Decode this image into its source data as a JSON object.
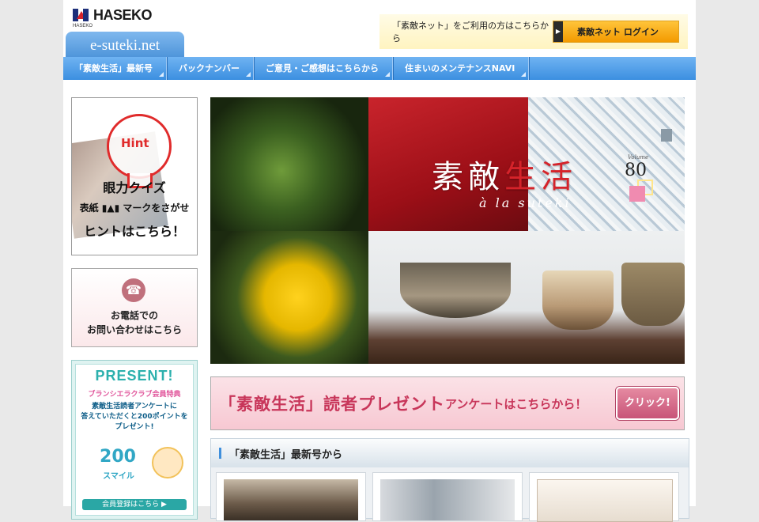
{
  "header": {
    "brand": "HASEKO",
    "brand_sub": "HASEKO",
    "site_tab": "e-suteki.net",
    "login_prompt": "「素敵ネット」をご利用の方はこちらから",
    "login_button": "素敵ネット ログイン"
  },
  "nav": {
    "items": [
      {
        "label": "「素敵生活」最新号"
      },
      {
        "label": "バックナンバー"
      },
      {
        "label": "ご意見・ご感想はこちらから"
      },
      {
        "label": "住まいのメンテナンスNAVI"
      }
    ]
  },
  "sidebar": {
    "hint": {
      "word": "Hint",
      "line1": "眼力クイズ",
      "line2": "表紙 ▮▲▮ マークをさがせ",
      "line3": "ヒントはこちら！"
    },
    "phone": {
      "icon": "phone-icon",
      "line1": "お電話での",
      "line2": "お問い合わせはこちら"
    },
    "present": {
      "title": "PRESENT!",
      "subtitle": "ブランシエラクラブ会員特典",
      "body1": "素敵生活読者アンケートに",
      "body2": "答えていただくと200ポイントを",
      "body3": "プレゼント!",
      "points": "200",
      "unit": "スマイル",
      "button": "会員登録はこちら ▶"
    }
  },
  "hero": {
    "title_a": "素敵",
    "title_b": "生活",
    "subtitle": "à la suteki",
    "vol_label": "Volume",
    "vol": "80"
  },
  "banner": {
    "main": "「素敵生活」読者プレゼント",
    "rest": "アンケートはこちらから！",
    "button": "クリック!"
  },
  "latest": {
    "title": "「素敵生活」最新号から"
  },
  "colors": {
    "nav": "#3c8fe0",
    "accent_red": "#d6232a",
    "banner_pink": "#c8365a",
    "login_orange": "#f39a00"
  }
}
